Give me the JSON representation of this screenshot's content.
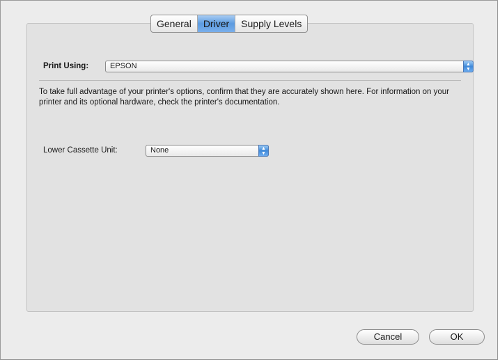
{
  "tabs": [
    {
      "label": "General",
      "selected": false
    },
    {
      "label": "Driver",
      "selected": true
    },
    {
      "label": "Supply Levels",
      "selected": false
    }
  ],
  "print_using": {
    "label": "Print Using:",
    "value": "EPSON"
  },
  "description": "To take full advantage of your printer's options, confirm that they are accurately shown here. For information on your printer and its optional hardware, check the printer's documentation.",
  "lower_cassette": {
    "label": "Lower Cassette Unit:",
    "value": "None"
  },
  "buttons": {
    "cancel": "Cancel",
    "ok": "OK"
  },
  "colors": {
    "accent": "#5c9be0",
    "pane_bg": "#e2e2e2",
    "window_bg": "#ececec"
  }
}
